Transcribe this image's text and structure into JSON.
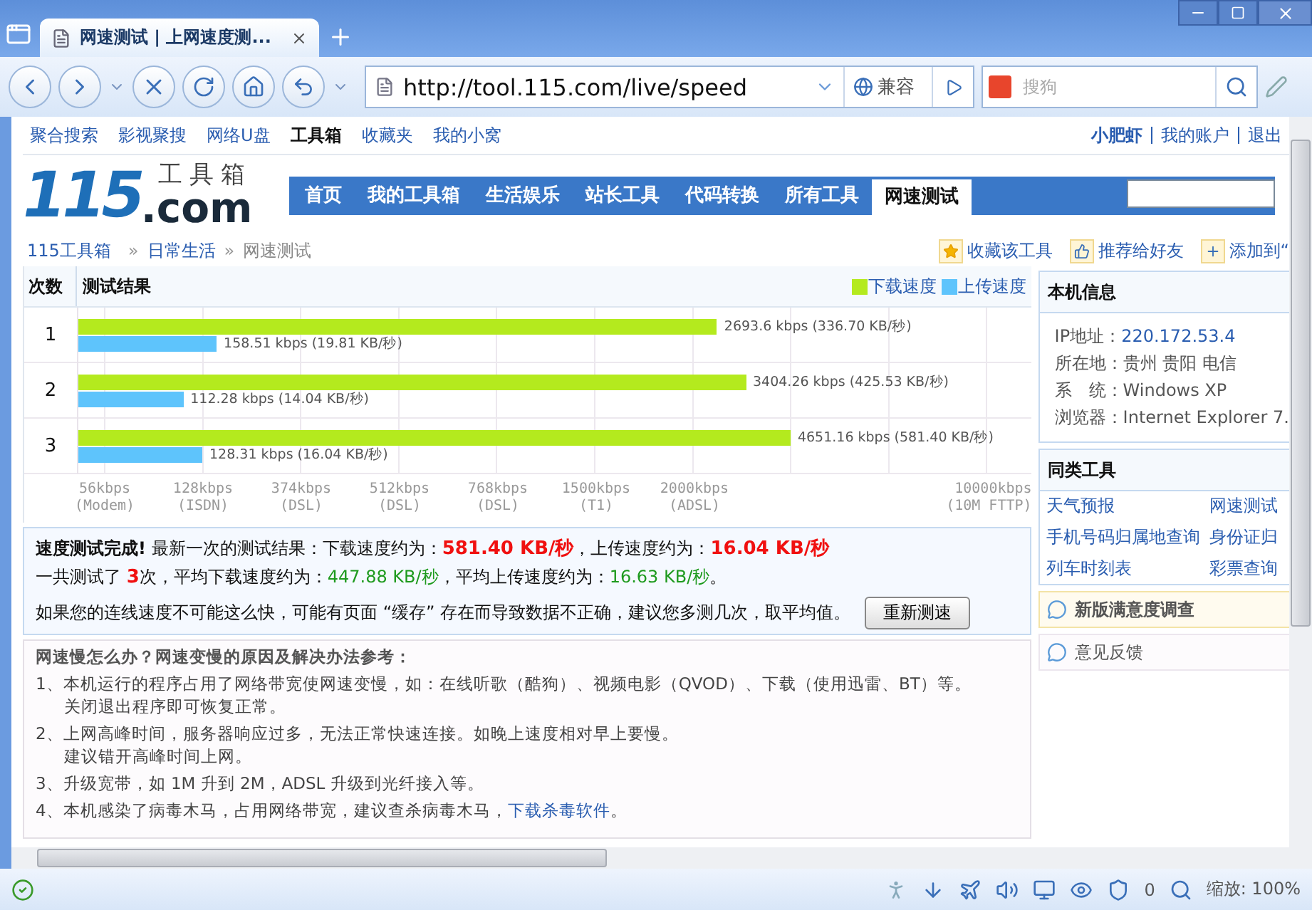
{
  "browser": {
    "tab_title": "网速测试 | 上网速度测...",
    "address": "http://tool.115.com/live/speed",
    "compat_label": "兼容",
    "search_placeholder": "搜狗"
  },
  "top_links": {
    "items": [
      {
        "label": "聚合搜索",
        "selected": false
      },
      {
        "label": "影视聚搜",
        "selected": false
      },
      {
        "label": "网络U盘",
        "selected": false
      },
      {
        "label": "工具箱",
        "selected": true
      },
      {
        "label": "收藏夹",
        "selected": false
      },
      {
        "label": "我的小窝",
        "selected": false
      }
    ],
    "user": "小肥虾",
    "account_links": [
      "我的账户",
      "退出"
    ]
  },
  "logo": {
    "number": "115",
    "domain": ".com",
    "name": "工具箱"
  },
  "nav": [
    {
      "label": "首页",
      "selected": false
    },
    {
      "label": "我的工具箱",
      "selected": false
    },
    {
      "label": "生活娱乐",
      "selected": false
    },
    {
      "label": "站长工具",
      "selected": false
    },
    {
      "label": "代码转换",
      "selected": false
    },
    {
      "label": "所有工具",
      "selected": false
    },
    {
      "label": "网速测试",
      "selected": true
    }
  ],
  "breadcrumb": {
    "items": [
      "115工具箱",
      "日常生活",
      "网速测试"
    ],
    "separator": "»"
  },
  "actions": [
    "收藏该工具",
    "推荐给好友",
    "添加到“"
  ],
  "test_results": {
    "columns": [
      "次数",
      "测试结果"
    ],
    "legend": [
      {
        "label": "下载速度",
        "color": "#b4ea1e"
      },
      {
        "label": "上传速度",
        "color": "#5ec4fc"
      }
    ],
    "rows": [
      {
        "number": "1",
        "bars": [
          {
            "level": 0.67,
            "reading": "2693.6 kbps (336.70 KB/秒)"
          },
          {
            "level": 0.145,
            "reading": "158.51 kbps (19.81 KB/秒)"
          }
        ]
      },
      {
        "number": "2",
        "bars": [
          {
            "level": 0.7,
            "reading": "3404.26 kbps (425.53 KB/秒)"
          },
          {
            "level": 0.11,
            "reading": "112.28 kbps (14.04 KB/秒)"
          }
        ]
      },
      {
        "number": "3",
        "bars": [
          {
            "level": 0.747,
            "reading": "4651.16 kbps (581.40 KB/秒)"
          },
          {
            "level": 0.13,
            "reading": "128.31 kbps (16.04 KB/秒)"
          }
        ]
      }
    ],
    "axis_labels": [
      {
        "speed": "56kbps",
        "type": "(Modem)"
      },
      {
        "speed": "128kbps",
        "type": "(ISDN)"
      },
      {
        "speed": "374kbps",
        "type": "(DSL)"
      },
      {
        "speed": "512kbps",
        "type": "(DSL)"
      },
      {
        "speed": "768kbps",
        "type": "(DSL)"
      },
      {
        "speed": "1500kbps",
        "type": "(T1)"
      },
      {
        "speed": "2000kbps",
        "type": "(ADSL)"
      },
      {
        "speed": "10000kbps",
        "type": "(10M FTTP)"
      }
    ]
  },
  "summary": {
    "lines": [
      [
        {
          "text": "速度测试完成!",
          "kind": "strong"
        },
        {
          "text": " 最新一次的测试结果：下载速度约为：",
          "kind": "plain"
        },
        {
          "text": "581.40 KB/秒",
          "kind": "alert"
        },
        {
          "text": "，上传速度约为：",
          "kind": "plain"
        },
        {
          "text": "16.04 KB/秒",
          "kind": "alert"
        }
      ],
      [
        {
          "text": "一共测试了 ",
          "kind": "plain"
        },
        {
          "text": "3",
          "kind": "alert"
        },
        {
          "text": "次，平均下载速度约为：",
          "kind": "plain"
        },
        {
          "text": "447.88 KB/秒",
          "kind": "average"
        },
        {
          "text": "，平均上传速度约为：",
          "kind": "plain"
        },
        {
          "text": "16.63 KB/秒",
          "kind": "average"
        },
        {
          "text": "。",
          "kind": "plain"
        }
      ]
    ],
    "note": "如果您的连线速度不可能这么快，可能有页面 “缓存” 存在而导致数据不正确，建议您多测几次，取平均值。",
    "retest_button": "重新测速"
  },
  "tips": {
    "title": "网速慢怎么办？网速变慢的原因及解决办法参考：",
    "items": [
      {
        "lines": [
          "1、本机运行的程序占用了网络带宽使网速变慢，如：在线听歌（酷狗）、视频电影（QVOD）、下载（使用迅雷、BT）等。",
          "关闭退出程序即可恢复正常。"
        ]
      },
      {
        "lines": [
          "2、上网高峰时间，服务器响应过多，无法正常快速连接。如晚上速度相对早上要慢。",
          "建议错开高峰时间上网。"
        ]
      },
      {
        "lines": [
          "3、升级宽带，如 1M 升到 2M，ADSL 升级到光纤接入等。"
        ]
      },
      {
        "lines": [
          "4、本机感染了病毒木马，占用网络带宽，建议查杀病毒木马，"
        ],
        "link": "下载杀毒软件",
        "after": "。"
      }
    ]
  },
  "sidebar": {
    "machine_info": {
      "title": "本机信息",
      "rows": [
        {
          "label": "IP地址：",
          "value": "220.172.53.4",
          "kind": "link"
        },
        {
          "label": "所在地：",
          "value": "贵州  贵阳  电信",
          "kind": "text"
        },
        {
          "label": "系　统：",
          "value": "Windows XP",
          "kind": "text"
        },
        {
          "label": "浏览器：",
          "value": "Internet Explorer 7.",
          "kind": "text"
        }
      ]
    },
    "similar_tools": {
      "title": "同类工具",
      "links": [
        "天气预报",
        "网速测试",
        "手机号码归属地查询",
        "身份证归",
        "列车时刻表",
        "彩票查询"
      ]
    },
    "survey": "新版满意度调查",
    "feedback": "意见反馈"
  },
  "status_bar": {
    "shield_count": "0",
    "zoom": "缩放: 100%"
  }
}
